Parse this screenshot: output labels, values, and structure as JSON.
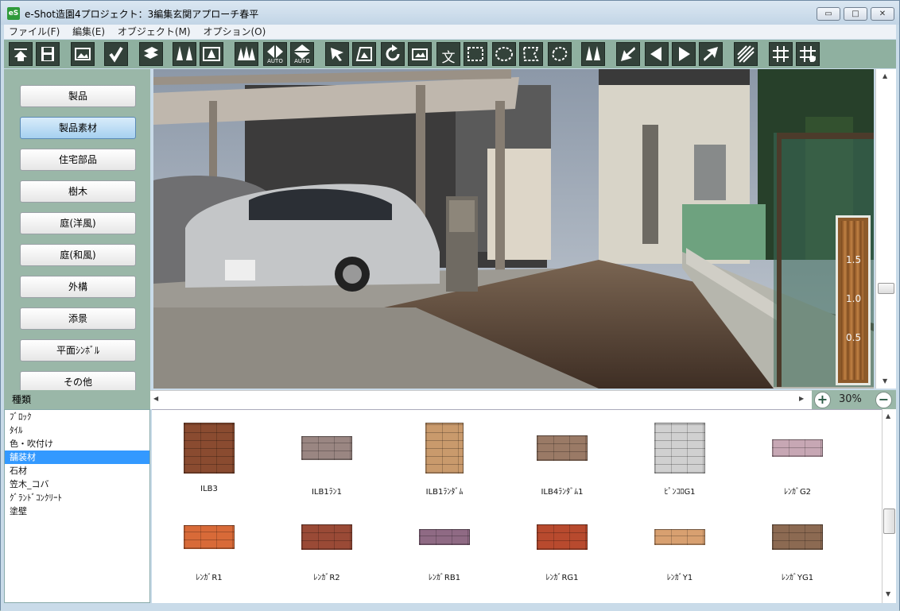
{
  "window": {
    "app_icon": "eS",
    "title": "e-Shot造園4プロジェクト：3編集玄関アプローチ春平",
    "controls": {
      "minimize": "▭",
      "maximize": "□",
      "close": "✕"
    }
  },
  "menubar": {
    "items": [
      "ファイル(F)",
      "編集(E)",
      "オブジェクト(M)",
      "オプション(O)"
    ]
  },
  "toolbar": {
    "buttons": [
      {
        "icon": "import-icon"
      },
      {
        "icon": "save-icon"
      },
      {
        "icon": "image-icon"
      },
      {
        "icon": "check-icon"
      },
      {
        "icon": "layer-icon"
      },
      {
        "icon": "trees-icon"
      },
      {
        "icon": "photo-tree-icon"
      },
      {
        "icon": "multi-trees-icon"
      },
      {
        "icon": "auto-horizontal-icon",
        "label": "AUTO"
      },
      {
        "icon": "auto-vertical-icon",
        "label": "AUTO"
      },
      {
        "icon": "select-arrow-icon"
      },
      {
        "icon": "perspective-icon"
      },
      {
        "icon": "rotate-icon"
      },
      {
        "icon": "picture-icon"
      },
      {
        "icon": "text-icon",
        "label": "文"
      },
      {
        "icon": "rect-select-icon"
      },
      {
        "icon": "ellipse-select-icon"
      },
      {
        "icon": "polygon-select-icon"
      },
      {
        "icon": "freeform-select-icon"
      },
      {
        "icon": "mirror-trees-icon"
      },
      {
        "icon": "arrow-down-left-icon"
      },
      {
        "icon": "arrow-left-icon"
      },
      {
        "icon": "arrow-right-icon"
      },
      {
        "icon": "arrow-up-right-icon"
      },
      {
        "icon": "hatch-icon"
      },
      {
        "icon": "grid-icon"
      },
      {
        "icon": "grid-settings-icon"
      }
    ]
  },
  "sidebar": {
    "categories": [
      {
        "label": "製品"
      },
      {
        "label": "製品素材",
        "active": true
      },
      {
        "label": "住宅部品"
      },
      {
        "label": "樹木"
      },
      {
        "label": "庭(洋風)"
      },
      {
        "label": "庭(和風)"
      },
      {
        "label": "外構"
      },
      {
        "label": "添景"
      },
      {
        "label": "平面ｼﾝﾎﾞﾙ"
      },
      {
        "label": "その他"
      }
    ]
  },
  "canvas": {
    "ruler_labels": [
      "1.5",
      "1.0",
      "0.5"
    ],
    "zoom_level": "30%"
  },
  "kinds": {
    "header": "種類",
    "items": [
      {
        "label": "ﾌﾞﾛｯｸ"
      },
      {
        "label": "ﾀｲﾙ"
      },
      {
        "label": "色・吹付け"
      },
      {
        "label": "舗装材",
        "selected": true
      },
      {
        "label": "石材"
      },
      {
        "label": "笠木_コバ"
      },
      {
        "label": "ｸﾞﾗﾝﾄﾞｺﾝｸﾘｰﾄ"
      },
      {
        "label": "塗壁"
      }
    ]
  },
  "materials": [
    {
      "label": "ILB3",
      "color": "#8a4b30"
    },
    {
      "label": "ILB1ﾗﾝ1",
      "color": "#9a8682"
    },
    {
      "label": "ILB1ﾗﾝﾀﾞﾑ",
      "color": "#c99a6c"
    },
    {
      "label": "ILB4ﾗﾝﾀﾞﾑ1",
      "color": "#9a7a66"
    },
    {
      "label": "ﾋﾟﾝｺﾛG1",
      "color": "#d0d0d0"
    },
    {
      "label": "ﾚﾝｶﾞG2",
      "color": "#c7a7b4"
    },
    {
      "label": "ﾚﾝｶﾞR1",
      "color": "#d86a38"
    },
    {
      "label": "ﾚﾝｶﾞR2",
      "color": "#9a4a36"
    },
    {
      "label": "ﾚﾝｶﾞRB1",
      "color": "#8f6a84"
    },
    {
      "label": "ﾚﾝｶﾞRG1",
      "color": "#b84a2e"
    },
    {
      "label": "ﾚﾝｶﾞY1",
      "color": "#d8a070"
    },
    {
      "label": "ﾚﾝｶﾞYG1",
      "color": "#8c6a52"
    }
  ]
}
